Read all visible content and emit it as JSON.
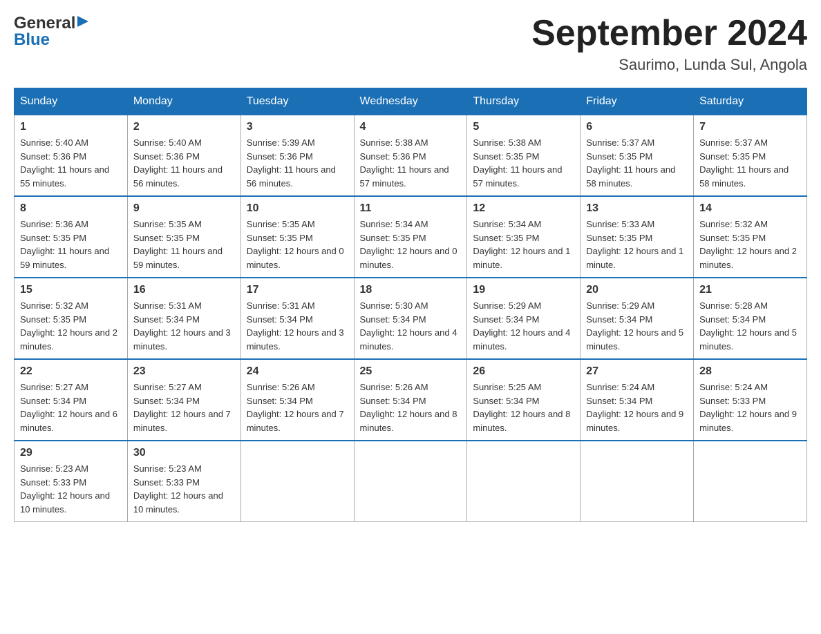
{
  "header": {
    "logo_line1": "General",
    "logo_line2": "Blue",
    "title": "September 2024",
    "subtitle": "Saurimo, Lunda Sul, Angola"
  },
  "weekdays": [
    "Sunday",
    "Monday",
    "Tuesday",
    "Wednesday",
    "Thursday",
    "Friday",
    "Saturday"
  ],
  "weeks": [
    [
      {
        "day": "1",
        "sunrise": "5:40 AM",
        "sunset": "5:36 PM",
        "daylight": "11 hours and 55 minutes."
      },
      {
        "day": "2",
        "sunrise": "5:40 AM",
        "sunset": "5:36 PM",
        "daylight": "11 hours and 56 minutes."
      },
      {
        "day": "3",
        "sunrise": "5:39 AM",
        "sunset": "5:36 PM",
        "daylight": "11 hours and 56 minutes."
      },
      {
        "day": "4",
        "sunrise": "5:38 AM",
        "sunset": "5:36 PM",
        "daylight": "11 hours and 57 minutes."
      },
      {
        "day": "5",
        "sunrise": "5:38 AM",
        "sunset": "5:35 PM",
        "daylight": "11 hours and 57 minutes."
      },
      {
        "day": "6",
        "sunrise": "5:37 AM",
        "sunset": "5:35 PM",
        "daylight": "11 hours and 58 minutes."
      },
      {
        "day": "7",
        "sunrise": "5:37 AM",
        "sunset": "5:35 PM",
        "daylight": "11 hours and 58 minutes."
      }
    ],
    [
      {
        "day": "8",
        "sunrise": "5:36 AM",
        "sunset": "5:35 PM",
        "daylight": "11 hours and 59 minutes."
      },
      {
        "day": "9",
        "sunrise": "5:35 AM",
        "sunset": "5:35 PM",
        "daylight": "11 hours and 59 minutes."
      },
      {
        "day": "10",
        "sunrise": "5:35 AM",
        "sunset": "5:35 PM",
        "daylight": "12 hours and 0 minutes."
      },
      {
        "day": "11",
        "sunrise": "5:34 AM",
        "sunset": "5:35 PM",
        "daylight": "12 hours and 0 minutes."
      },
      {
        "day": "12",
        "sunrise": "5:34 AM",
        "sunset": "5:35 PM",
        "daylight": "12 hours and 1 minute."
      },
      {
        "day": "13",
        "sunrise": "5:33 AM",
        "sunset": "5:35 PM",
        "daylight": "12 hours and 1 minute."
      },
      {
        "day": "14",
        "sunrise": "5:32 AM",
        "sunset": "5:35 PM",
        "daylight": "12 hours and 2 minutes."
      }
    ],
    [
      {
        "day": "15",
        "sunrise": "5:32 AM",
        "sunset": "5:35 PM",
        "daylight": "12 hours and 2 minutes."
      },
      {
        "day": "16",
        "sunrise": "5:31 AM",
        "sunset": "5:34 PM",
        "daylight": "12 hours and 3 minutes."
      },
      {
        "day": "17",
        "sunrise": "5:31 AM",
        "sunset": "5:34 PM",
        "daylight": "12 hours and 3 minutes."
      },
      {
        "day": "18",
        "sunrise": "5:30 AM",
        "sunset": "5:34 PM",
        "daylight": "12 hours and 4 minutes."
      },
      {
        "day": "19",
        "sunrise": "5:29 AM",
        "sunset": "5:34 PM",
        "daylight": "12 hours and 4 minutes."
      },
      {
        "day": "20",
        "sunrise": "5:29 AM",
        "sunset": "5:34 PM",
        "daylight": "12 hours and 5 minutes."
      },
      {
        "day": "21",
        "sunrise": "5:28 AM",
        "sunset": "5:34 PM",
        "daylight": "12 hours and 5 minutes."
      }
    ],
    [
      {
        "day": "22",
        "sunrise": "5:27 AM",
        "sunset": "5:34 PM",
        "daylight": "12 hours and 6 minutes."
      },
      {
        "day": "23",
        "sunrise": "5:27 AM",
        "sunset": "5:34 PM",
        "daylight": "12 hours and 7 minutes."
      },
      {
        "day": "24",
        "sunrise": "5:26 AM",
        "sunset": "5:34 PM",
        "daylight": "12 hours and 7 minutes."
      },
      {
        "day": "25",
        "sunrise": "5:26 AM",
        "sunset": "5:34 PM",
        "daylight": "12 hours and 8 minutes."
      },
      {
        "day": "26",
        "sunrise": "5:25 AM",
        "sunset": "5:34 PM",
        "daylight": "12 hours and 8 minutes."
      },
      {
        "day": "27",
        "sunrise": "5:24 AM",
        "sunset": "5:34 PM",
        "daylight": "12 hours and 9 minutes."
      },
      {
        "day": "28",
        "sunrise": "5:24 AM",
        "sunset": "5:33 PM",
        "daylight": "12 hours and 9 minutes."
      }
    ],
    [
      {
        "day": "29",
        "sunrise": "5:23 AM",
        "sunset": "5:33 PM",
        "daylight": "12 hours and 10 minutes."
      },
      {
        "day": "30",
        "sunrise": "5:23 AM",
        "sunset": "5:33 PM",
        "daylight": "12 hours and 10 minutes."
      },
      null,
      null,
      null,
      null,
      null
    ]
  ],
  "labels": {
    "sunrise": "Sunrise:",
    "sunset": "Sunset:",
    "daylight": "Daylight:"
  }
}
